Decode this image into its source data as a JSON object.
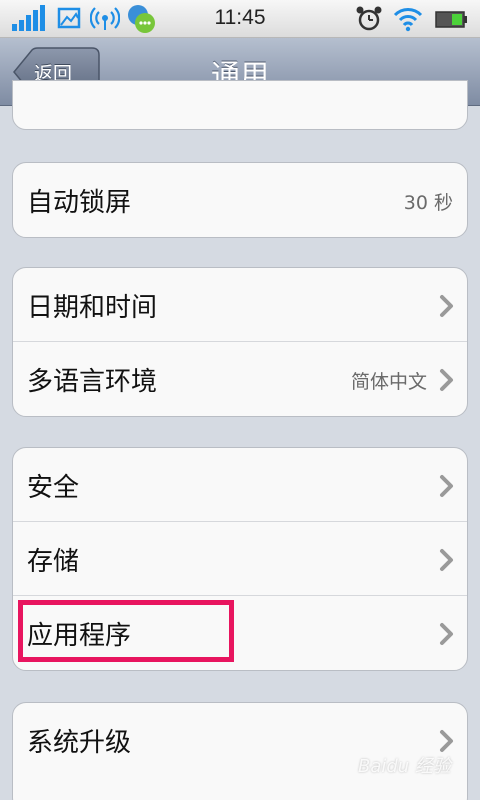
{
  "status_bar": {
    "time": "11:45",
    "icons": [
      "signal-icon",
      "image-icon",
      "wifi-hotspot-icon",
      "chat-app-icon",
      "alarm-icon",
      "wifi-icon",
      "battery-icon"
    ]
  },
  "nav": {
    "back_label": "返回",
    "title": "通用"
  },
  "groups": [
    {
      "rows": [
        {
          "label": "自动锁屏",
          "value": "30 秒",
          "chevron": false
        }
      ]
    },
    {
      "rows": [
        {
          "label": "日期和时间",
          "value": "",
          "chevron": true
        },
        {
          "label": "多语言环境",
          "value": "简体中文",
          "chevron": true
        }
      ]
    },
    {
      "rows": [
        {
          "label": "安全",
          "value": "",
          "chevron": true
        },
        {
          "label": "存储",
          "value": "",
          "chevron": true
        },
        {
          "label": "应用程序",
          "value": "",
          "chevron": true
        }
      ]
    },
    {
      "rows": [
        {
          "label": "系统升级",
          "value": "",
          "chevron": true
        }
      ]
    }
  ],
  "watermark": "Baidu 经验",
  "colors": {
    "nav_bar": "#8f9bb0",
    "background": "#d5dae2",
    "highlight": "#e8155f",
    "chevron": "#9a9a9a"
  }
}
